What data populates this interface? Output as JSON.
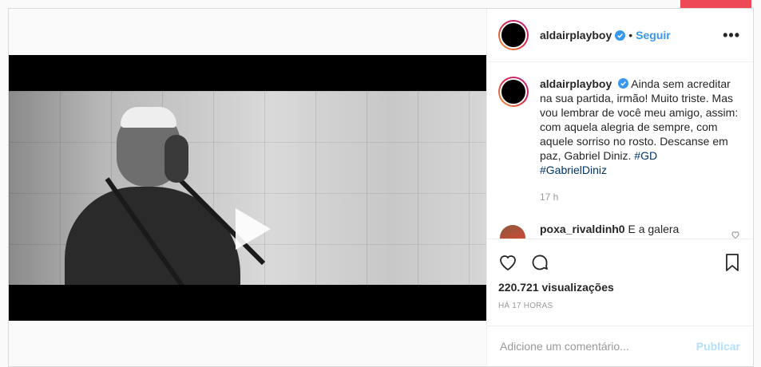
{
  "post": {
    "username": "aldairplayboy",
    "dot": "•",
    "follow_label": "Seguir",
    "more_label": "•••",
    "caption": {
      "username": "aldairplayboy",
      "text": "Ainda sem acreditar na sua partida, irmão! Muito triste. Mas vou lembrar de você meu amigo, assim: com aquela alegria de sempre, com aquele sorriso no rosto. Descanse em paz, Gabriel Diniz.",
      "hashtags": [
        "#GD",
        "#GabrielDiniz"
      ],
      "time": "17 h"
    },
    "comment": {
      "username": "poxa_rivaldinh0",
      "text": "E a galera atacando o Carlinhos... Whiderson"
    },
    "views": "220.721 visualizações",
    "posted_ago": "HÁ 17 HORAS",
    "add_comment_placeholder": "Adicione um comentário...",
    "publish_label": "Publicar"
  },
  "colors": {
    "accent": "#3897f0",
    "publish_disabled": "#b2dffc",
    "notification": "#ed4956",
    "hashtag": "#003569"
  }
}
